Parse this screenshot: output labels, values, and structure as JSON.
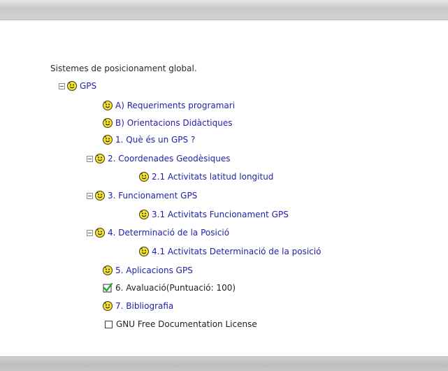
{
  "intro_text": "Sistemes de posicionament global.",
  "tree": {
    "root": {
      "label": "GPS"
    },
    "items": [
      {
        "label": "A) Requeriments programari"
      },
      {
        "label": "B) Orientacions Didàctiques"
      },
      {
        "label": "1. Què és un GPS ?"
      },
      {
        "label": "2. Coordenades Geodèsiques"
      },
      {
        "label": "2.1 Activitats latitud longitud"
      },
      {
        "label": "3. Funcionament GPS"
      },
      {
        "label": "3.1 Activitats Funcionament GPS"
      },
      {
        "label": "4. Determinació de la Posició"
      },
      {
        "label": "4.1 Activitats Determinació de la posició"
      },
      {
        "label": "5. Aplicacions GPS"
      },
      {
        "label": "6. Avaluació(Puntuació: 100)"
      },
      {
        "label": "7. Bibliografia"
      },
      {
        "label": "GNU Free Documentation License"
      }
    ]
  },
  "colors": {
    "link": "#1f1fa8",
    "text": "#1f1f1f",
    "chrome": "#cfcfcf"
  },
  "icons": {
    "node": "smiley-icon",
    "completed": "checkmark-icon",
    "unstarted": "checkbox-icon",
    "expand": "collapse-minus-icon"
  }
}
